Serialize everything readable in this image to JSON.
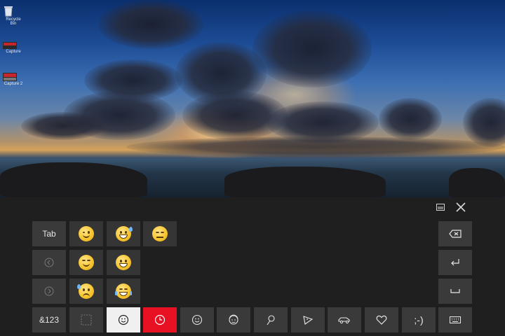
{
  "desktop": {
    "icons": [
      {
        "label": "Recycle Bin",
        "icon": "recycle-bin-icon"
      },
      {
        "label": "Capture",
        "icon": "capture-icon"
      },
      {
        "label": "Capture 2",
        "icon": "capture-icon"
      }
    ]
  },
  "keyboard": {
    "top_controls": {
      "undock": "keyboard-undock-icon",
      "close": "close-icon"
    },
    "left_column": [
      {
        "label": "Tab"
      },
      {
        "label": "",
        "icon": "previous-page-icon"
      },
      {
        "label": "",
        "icon": "next-page-icon"
      },
      {
        "label": "&123"
      }
    ],
    "emoji_grid": [
      [
        "winking-face",
        "smiling-face-with-open-mouth-and-cold-sweat",
        "unamused-face"
      ],
      [
        "smiling-face-with-smiling-eyes",
        "grinning-face-with-smiling-eyes"
      ],
      [
        "worried-face-with-sweat",
        "face-with-tears-of-joy"
      ]
    ],
    "category_row": [
      {
        "icon": "ninja-cat-icon",
        "active": false
      },
      {
        "icon": "smiley-category-icon",
        "active": "selected"
      },
      {
        "icon": "recent-clock-icon",
        "active": "highlight"
      },
      {
        "icon": "smiley-faces-icon",
        "active": false
      },
      {
        "icon": "people-icon",
        "active": false
      },
      {
        "icon": "celebration-icon",
        "active": false
      },
      {
        "icon": "food-icon",
        "active": false
      },
      {
        "icon": "transport-icon",
        "active": false
      },
      {
        "icon": "heart-icon",
        "active": false
      },
      {
        "label": ";-)",
        "icon": "text-emoticon",
        "active": false
      },
      {
        "icon": "keyboard-icon",
        "active": false
      }
    ],
    "right_column": [
      {
        "icon": "backspace-icon"
      },
      {
        "icon": "enter-icon"
      },
      {
        "icon": "space-icon"
      }
    ],
    "colors": {
      "background": "#1f1f1f",
      "key": "#3a3a3a",
      "accent": "#e81123",
      "selected": "#f0f0f0"
    }
  }
}
